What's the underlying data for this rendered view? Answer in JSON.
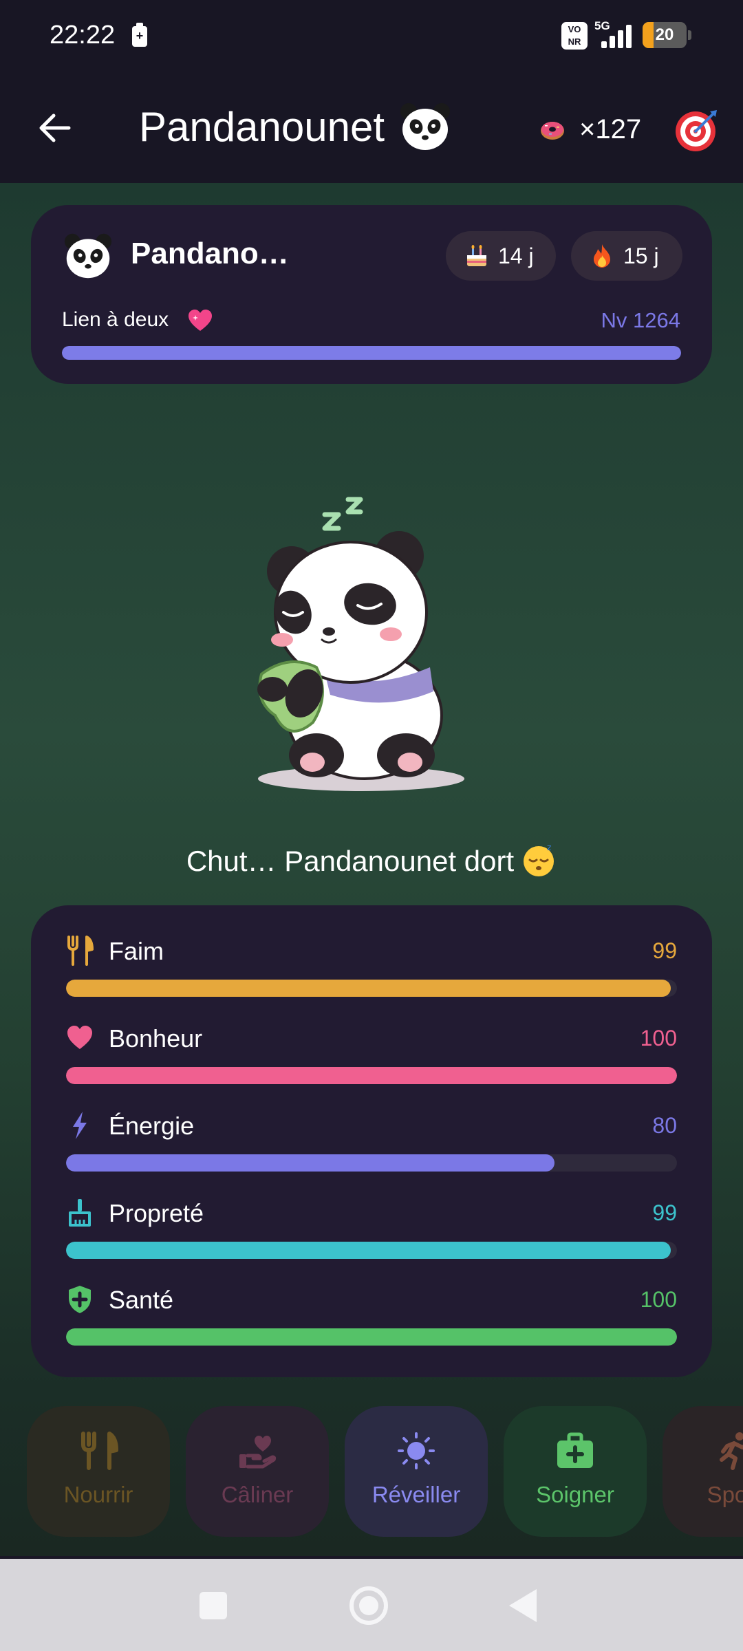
{
  "status_bar": {
    "time": "22:22",
    "volte_badge": "VO NR",
    "network": "5G",
    "battery_level": "20",
    "icons": [
      "battery-saver-icon",
      "volte-icon",
      "signal-icon",
      "battery-icon"
    ]
  },
  "header": {
    "title": "Pandanounet",
    "title_emoji": "panda-face-icon",
    "coins": "×127",
    "coin_icon": "donut-icon",
    "target_icon": "target-icon"
  },
  "pet_card": {
    "name": "Pandano…",
    "age": "14 j",
    "age_icon": "birthday-cake-icon",
    "streak": "15 j",
    "streak_icon": "fire-icon",
    "bond_label": "Lien à deux",
    "bond_icon": "sparkling-heart-icon",
    "bond_level": "Nv 1264",
    "bond_progress": 1.0,
    "accent": "#7d7ce8"
  },
  "scene": {
    "message": "Chut… Pandanounet dort",
    "message_emoji": "sleeping-face-icon",
    "pet_state": "sleeping"
  },
  "stats": [
    {
      "label": "Faim",
      "value": "99",
      "level": 0.99,
      "color": "#e6a83c",
      "icon": "fork-knife-icon"
    },
    {
      "label": "Bonheur",
      "value": "100",
      "level": 1.0,
      "color": "#f06090",
      "icon": "heart-icon"
    },
    {
      "label": "Énergie",
      "value": "80",
      "level": 0.8,
      "color": "#7b78e6",
      "icon": "lightning-icon"
    },
    {
      "label": "Propreté",
      "value": "99",
      "level": 0.99,
      "color": "#3cc3cd",
      "icon": "broom-icon"
    },
    {
      "label": "Santé",
      "value": "100",
      "level": 1.0,
      "color": "#55c268",
      "icon": "shield-plus-icon"
    }
  ],
  "actions": [
    {
      "label": "Nourrir",
      "icon": "fork-knife-icon",
      "color": "#6b5524",
      "bg": "#2a2a22",
      "state": "disabled"
    },
    {
      "label": "Câliner",
      "icon": "hand-heart-icon",
      "color": "#6a3a52",
      "bg": "#2a2230",
      "state": "disabled"
    },
    {
      "label": "Réveiller",
      "icon": "sun-icon",
      "color": "#8a8af0",
      "bg": "#2b2b44",
      "state": "active"
    },
    {
      "label": "Soigner",
      "icon": "first-aid-kit-icon",
      "color": "#5cc46a",
      "bg": "#1c3a2a",
      "state": "active"
    },
    {
      "label": "Sport",
      "icon": "running-icon",
      "color": "#7a4a3a",
      "bg": "#2a2426",
      "state": "disabled"
    }
  ],
  "nav_bar": {
    "icons": [
      "recents-icon",
      "home-icon",
      "back-icon"
    ]
  }
}
